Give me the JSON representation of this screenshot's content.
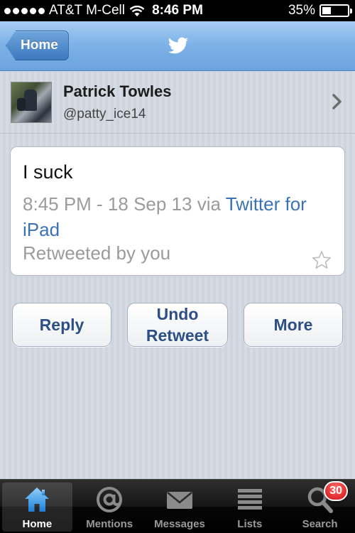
{
  "status_bar": {
    "carrier": "AT&T M-Cell",
    "time": "8:46 PM",
    "battery_text": "35%",
    "battery_level": 0.35
  },
  "nav": {
    "back_label": "Home",
    "logo_icon": "twitter-bird-icon"
  },
  "profile": {
    "name": "Patrick Towles",
    "handle": "@patty_ice14",
    "chevron_icon": "chevron-right-icon"
  },
  "tweet": {
    "text": "I suck",
    "meta_prefix": "8:45 PM - 18 Sep 13 via ",
    "client": "Twitter for iPad",
    "retweeted": "Retweeted by you",
    "star_icon": "star-icon"
  },
  "actions": {
    "reply": "Reply",
    "undo_line1": "Undo",
    "undo_line2": "Retweet",
    "more": "More"
  },
  "tabs": [
    {
      "label": "Home",
      "icon": "house-icon",
      "active": true
    },
    {
      "label": "Mentions",
      "icon": "at-icon"
    },
    {
      "label": "Messages",
      "icon": "envelope-icon"
    },
    {
      "label": "Lists",
      "icon": "list-icon"
    },
    {
      "label": "Search",
      "icon": "magnifier-icon",
      "badge": "30"
    }
  ],
  "colors": {
    "nav_blue": "#7fb3e8",
    "link_blue": "#3a73b5",
    "button_text": "#2d4f86",
    "badge_red": "#d10f0f"
  }
}
